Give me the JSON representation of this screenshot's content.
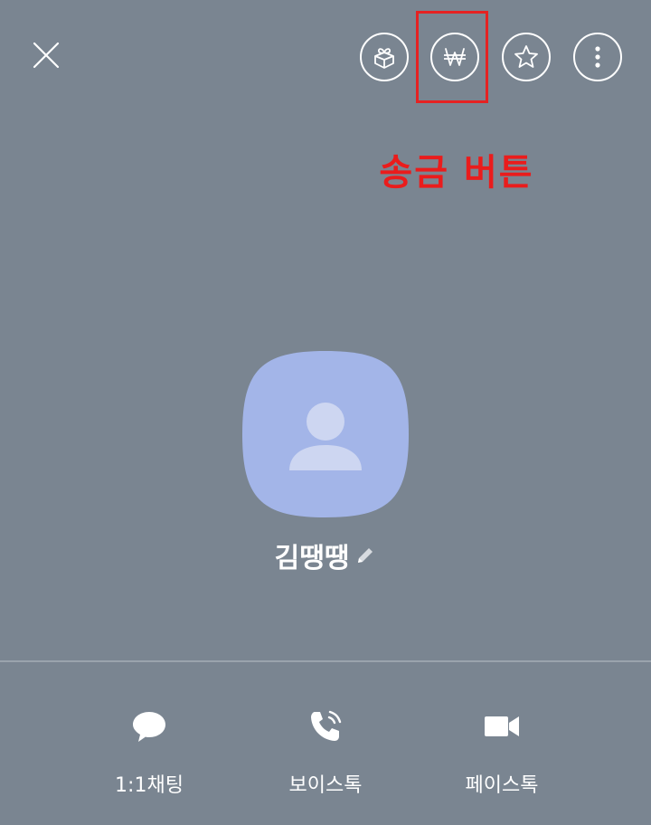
{
  "header": {
    "icons": {
      "close": "close-icon",
      "gift": "gift-box-icon",
      "remit": "won-currency-icon",
      "favorite": "star-icon",
      "more": "more-vertical-icon"
    }
  },
  "annotation": {
    "text": "송금 버튼",
    "color": "#ea1c1c"
  },
  "profile": {
    "name": "김땡땡",
    "avatar_color": "#a3b5e8"
  },
  "actions": [
    {
      "label": "1:1채팅",
      "icon": "chat-bubble-icon"
    },
    {
      "label": "보이스톡",
      "icon": "phone-call-icon"
    },
    {
      "label": "페이스톡",
      "icon": "video-camera-icon"
    }
  ],
  "colors": {
    "background": "#7a8591",
    "highlight": "#e52222"
  }
}
